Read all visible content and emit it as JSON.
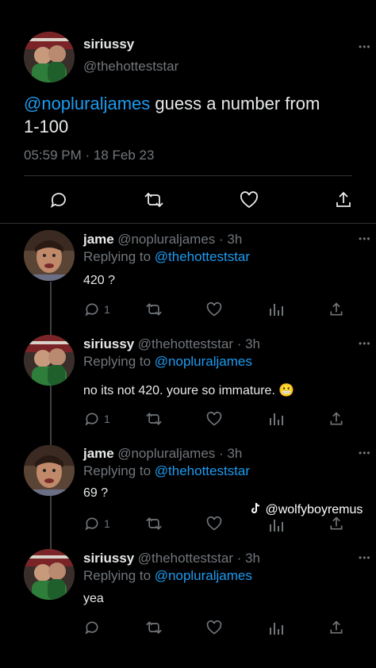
{
  "main_tweet": {
    "display_name": "siriussy",
    "handle": "@thehotteststar",
    "mention": "@nopluraljames",
    "text_line1": " guess a number from",
    "text_line2": "1-100",
    "timestamp": "05:59 PM · 18 Feb 23"
  },
  "replies": [
    {
      "display_name": "jame",
      "meta": "@nopluraljames · 3h",
      "replying_prefix": "Replying to ",
      "replying_to": "@thehotteststar",
      "text": "420 ?",
      "reply_count": "1"
    },
    {
      "display_name": "siriussy",
      "meta": "@thehotteststar · 3h",
      "replying_prefix": "Replying to ",
      "replying_to": "@nopluraljames",
      "text": "no its not 420. youre so immature. 😬",
      "reply_count": "1"
    },
    {
      "display_name": "jame",
      "meta": "@nopluraljames · 3h",
      "replying_prefix": "Replying to ",
      "replying_to": "@thehotteststar",
      "text": "69 ?",
      "reply_count": "1"
    },
    {
      "display_name": "siriussy",
      "meta": "@thehotteststar · 3h",
      "replying_prefix": "Replying to ",
      "replying_to": "@nopluraljames",
      "text": "yea",
      "reply_count": ""
    }
  ],
  "more_glyph": "•••",
  "watermark": {
    "icon": "tiktok-icon",
    "text": "@wolfyboyremus"
  },
  "colors": {
    "background": "#000000",
    "text": "#e7e9ea",
    "secondary": "#71767b",
    "link": "#1d9bf0",
    "divider": "#2f3336"
  }
}
